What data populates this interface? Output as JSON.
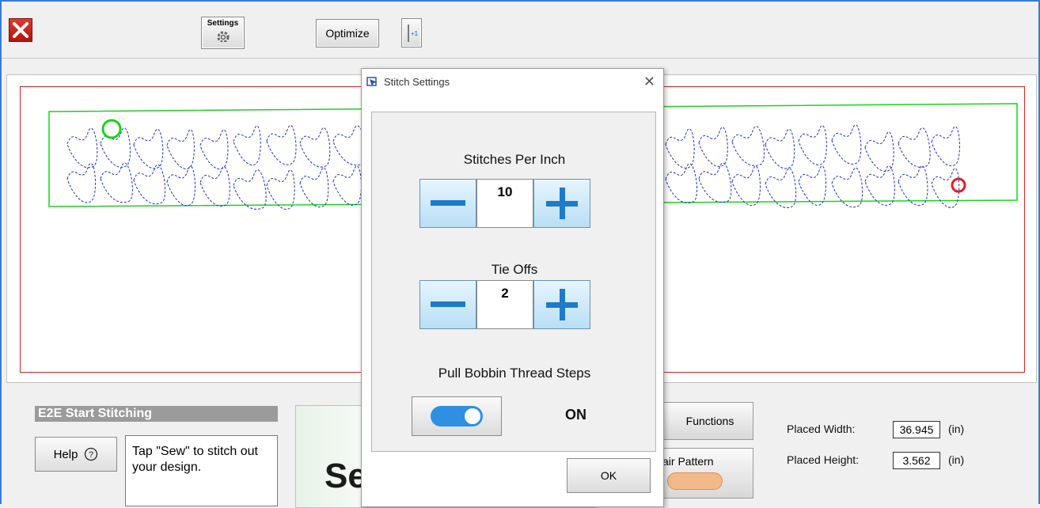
{
  "toolbar": {
    "close_icon": "close-icon",
    "settings_label": "Settings",
    "optimize_label": "Optimize",
    "needle_label": "+1"
  },
  "canvas": {
    "border_color": "#e02020",
    "pattern_color": "#1a2fd0",
    "frame_color": "#1ed020"
  },
  "bottom": {
    "mode_title": "E2E Start Stitching",
    "help_label": "Help",
    "tip_text": "Tap \"Sew\" to stitch out your design.",
    "sew_label": "Se",
    "functions_label": "Functions",
    "repair_label": "air Pattern",
    "placed_width_label": "Placed Width:",
    "placed_width_value": "36.945",
    "placed_height_label": "Placed Height:",
    "placed_height_value": "3.562",
    "unit": "(in)"
  },
  "dialog": {
    "title": "Stitch Settings",
    "spi_label": "Stitches Per Inch",
    "spi_value": "10",
    "tieoffs_label": "Tie Offs",
    "tieoffs_value": "2",
    "bobbin_label": "Pull Bobbin Thread Steps",
    "bobbin_state": "ON",
    "ok_label": "OK"
  }
}
